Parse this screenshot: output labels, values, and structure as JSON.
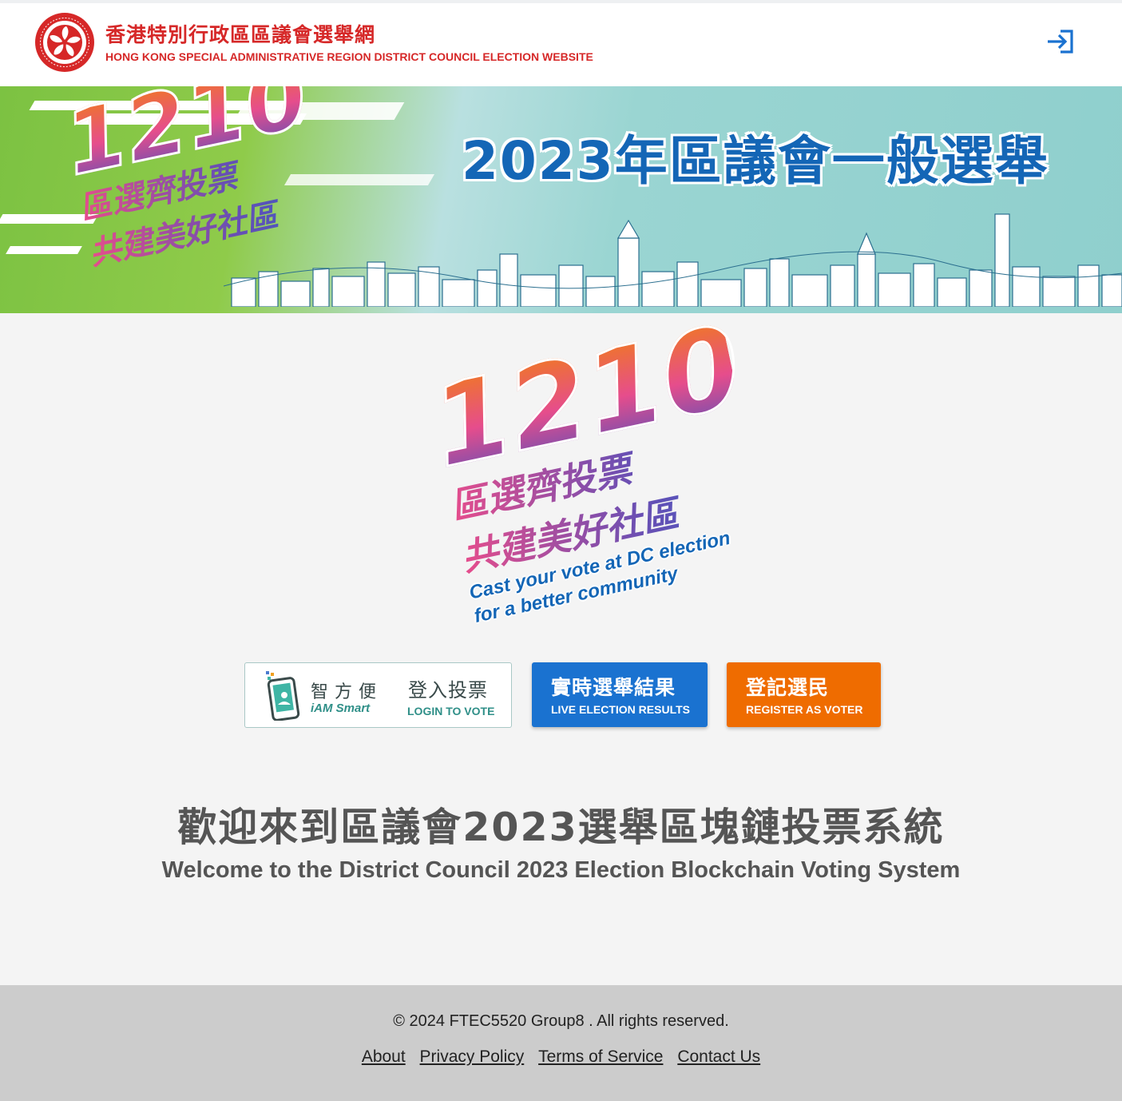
{
  "header": {
    "title_zh": "香港特別行政區區議會選舉網",
    "title_en": "HONG KONG SPECIAL ADMINISTRATIVE REGION DISTRICT COUNCIL ELECTION WEBSITE",
    "emblem_text": "HONG KONG",
    "login_icon": "login-icon"
  },
  "banner": {
    "title": "2023年區議會一般選舉",
    "slogan_number": "1210",
    "slogan_line1": "區選齊投票",
    "slogan_line2": "共建美好社區"
  },
  "logo": {
    "number": "1210",
    "line1": "區選齊投票",
    "line2": "共建美好社區",
    "en_line1": "Cast your vote at DC election",
    "en_line2": "for a better community"
  },
  "buttons": {
    "iam": {
      "brand_zh": "智方便",
      "brand_en": "iAM Smart",
      "label_zh": "登入投票",
      "label_en": "LOGIN TO VOTE"
    },
    "live": {
      "label_zh": "實時選舉結果",
      "label_en": "LIVE ELECTION RESULTS"
    },
    "register": {
      "label_zh": "登記選民",
      "label_en": "REGISTER AS VOTER"
    }
  },
  "welcome": {
    "zh": "歡迎來到區議會2023選舉區塊鏈投票系統",
    "en": "Welcome to the District Council 2023 Election Blockchain Voting System"
  },
  "footer": {
    "copyright": "© 2024 FTEC5520 Group8 . All rights reserved.",
    "links": [
      "About",
      "Privacy Policy",
      "Terms of Service",
      "Contact Us"
    ]
  },
  "colors": {
    "brand_red": "#d62828",
    "accent_blue": "#1a72d0",
    "accent_orange": "#ef6c00",
    "iam_teal": "#2f8f88",
    "footer_bg": "#cccccc"
  }
}
